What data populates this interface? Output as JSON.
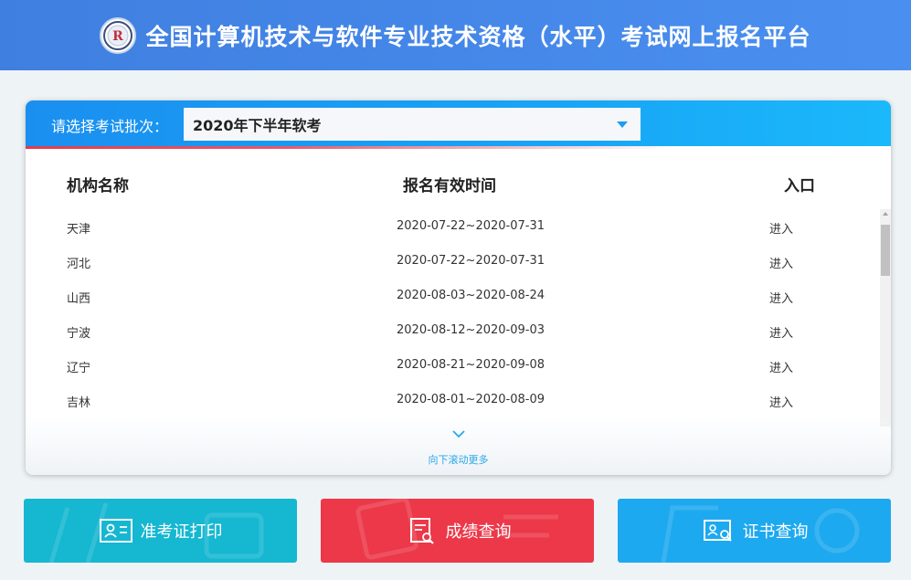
{
  "header": {
    "title": "全国计算机技术与软件专业技术资格（水平）考试网上报名平台",
    "logo_icon": "exam-logo-icon"
  },
  "selector": {
    "label": "请选择考试批次：",
    "value": "2020年下半年软考"
  },
  "table": {
    "headers": {
      "name": "机构名称",
      "time": "报名有效时间",
      "entry": "入口"
    },
    "rows": [
      {
        "name": "天津",
        "time": "2020-07-22~2020-07-31",
        "entry": "进入"
      },
      {
        "name": "河北",
        "time": "2020-07-22~2020-07-31",
        "entry": "进入"
      },
      {
        "name": "山西",
        "time": "2020-08-03~2020-08-24",
        "entry": "进入"
      },
      {
        "name": "宁波",
        "time": "2020-08-12~2020-09-03",
        "entry": "进入"
      },
      {
        "name": "辽宁",
        "time": "2020-08-21~2020-09-08",
        "entry": "进入"
      },
      {
        "name": "吉林",
        "time": "2020-08-01~2020-08-09",
        "entry": "进入"
      }
    ]
  },
  "scroll_more": "向下滚动更多",
  "buttons": {
    "admit_card": {
      "label": "准考证打印",
      "color": "#15b7d1",
      "icon": "id-card-icon"
    },
    "score": {
      "label": "成绩查询",
      "color": "#ec3848",
      "icon": "document-search-icon"
    },
    "certificate": {
      "label": "证书查询",
      "color": "#1da9ef",
      "icon": "certificate-search-icon"
    }
  },
  "colors": {
    "header": "#4a8ff0",
    "accent": "#1a8ff0",
    "link": "#2aa7e6"
  }
}
